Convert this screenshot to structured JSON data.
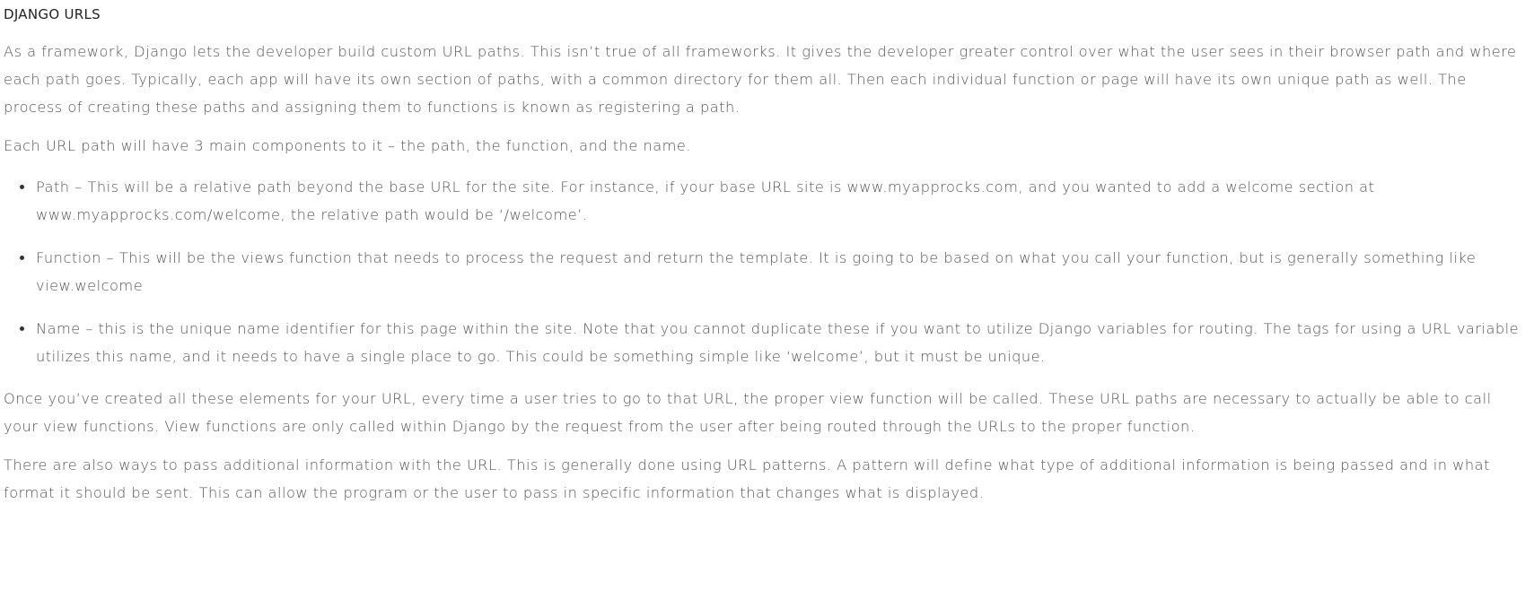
{
  "article": {
    "heading": "DJANGO URLS",
    "paragraphs": [
      "As a framework, Django lets the developer build custom URL paths. This isn’t true of all frameworks. It gives the developer greater control over what the user sees in their browser path and where each path goes. Typically, each app will have its own section of paths, with a common directory for them all. Then each individual function or page will have its own unique path as well. The process of creating these paths and assigning them to functions is known as registering a path.",
      "Each URL path will have 3 main components to it – the path, the function, and the name."
    ],
    "bullets": [
      "Path – This will be a relative path beyond the base URL for the site. For instance, if your base URL site is www.myapprocks.com, and you wanted to add a welcome section at www.myapprocks.com/welcome, the relative path would be ‘/welcome’.",
      "Function – This will be the views function that needs to process the request and return the template. It is going to be based on what you call your function, but is generally something like view.welcome",
      "Name – this is the unique name identifier for this page within the site. Note that you cannot duplicate these if you want to utilize Django variables for routing. The tags for using a URL variable utilizes this name, and it needs to have a single place to go. This could be something simple like ‘welcome’, but it must be unique."
    ],
    "closing_paragraphs": [
      "Once you’ve created all these elements for your URL, every time a user tries to go to that URL, the proper view function will be called. These URL paths are necessary to actually be able to call your view functions. View functions are only called within Django by the request from the user after being routed through the URLs to the proper function.",
      "There are also ways to pass additional information with the URL. This is generally done using URL patterns. A pattern will define what type of additional information is being passed and in what format it should be sent. This can allow the program or the user to pass in specific information that changes what is displayed."
    ]
  }
}
